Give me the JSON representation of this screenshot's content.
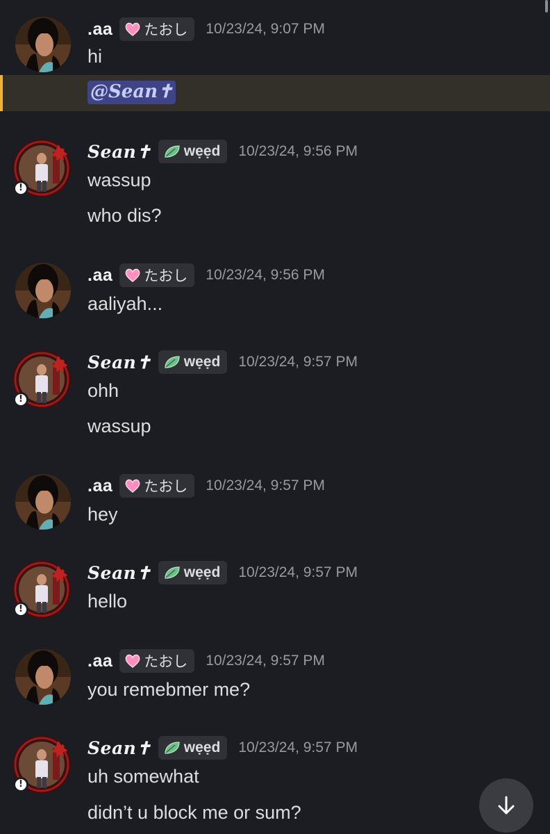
{
  "users": {
    "aa": {
      "name": ".aa",
      "tag": "たおし",
      "tag_icon": "pink-heart-icon"
    },
    "sean": {
      "name": "Sean✝",
      "tag": "wẹẹd",
      "tag_icon": "green-leaf-icon",
      "status": "!"
    }
  },
  "messages": [
    {
      "author": ".aa",
      "timestamp": "10/23/24, 9:07 PM",
      "lines": [
        "hi"
      ],
      "mention": "@Sean✝"
    },
    {
      "author": "Sean✝",
      "timestamp": "10/23/24, 9:56 PM",
      "lines": [
        "wassup",
        "who dis?"
      ]
    },
    {
      "author": ".aa",
      "timestamp": "10/23/24, 9:56 PM",
      "lines": [
        "aaliyah..."
      ]
    },
    {
      "author": "Sean✝",
      "timestamp": "10/23/24, 9:57 PM",
      "lines": [
        "ohh",
        "wassup"
      ]
    },
    {
      "author": ".aa",
      "timestamp": "10/23/24, 9:57 PM",
      "lines": [
        "hey"
      ]
    },
    {
      "author": "Sean✝",
      "timestamp": "10/23/24, 9:57 PM",
      "lines": [
        "hello"
      ]
    },
    {
      "author": ".aa",
      "timestamp": "10/23/24, 9:57 PM",
      "lines": [
        "you remebmer me?"
      ]
    },
    {
      "author": "Sean✝",
      "timestamp": "10/23/24, 9:57 PM",
      "lines": [
        "uh somewhat",
        "didn’t u block me or sum?"
      ]
    }
  ],
  "controls": {
    "scroll_to_bottom_icon": "arrow-down-icon"
  },
  "colors": {
    "background": "#1c1d22",
    "mention_highlight": "#33302a",
    "mention_bar": "#f0b232",
    "mention_pill": "#3e4486",
    "tag_background": "#2f3136",
    "timestamp": "#989aa2"
  }
}
